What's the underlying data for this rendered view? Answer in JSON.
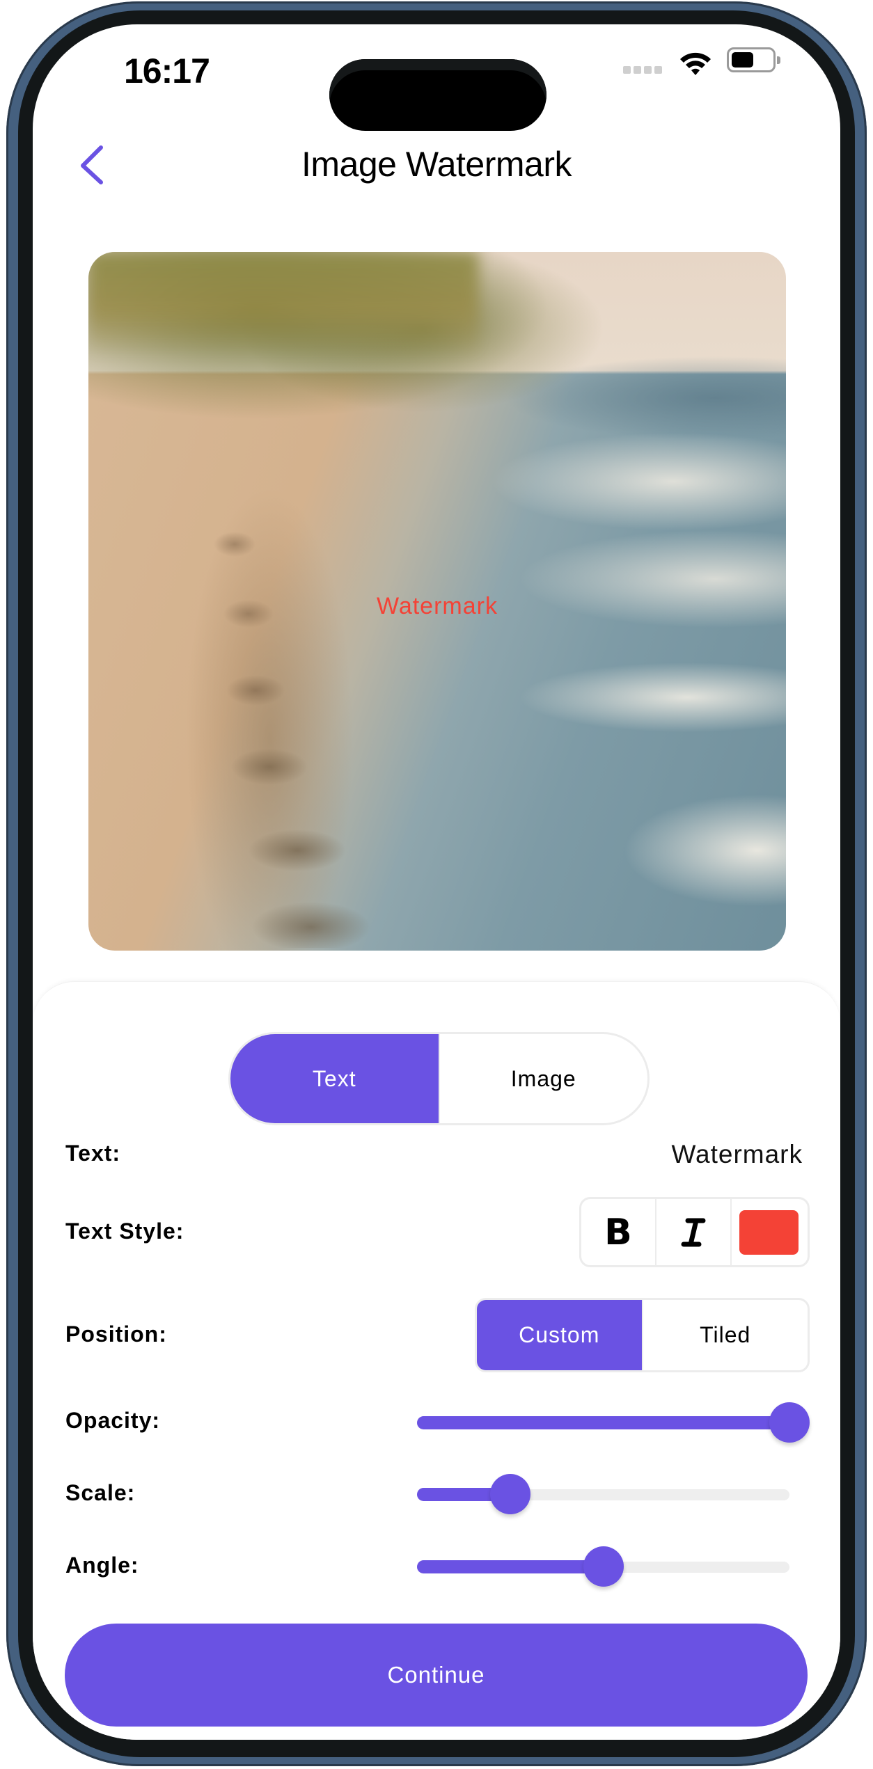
{
  "status_bar": {
    "time": "16:17",
    "icons": [
      "cellular-signal-icon",
      "wifi-icon",
      "battery-icon"
    ]
  },
  "header": {
    "back_icon": "chevron-left-icon",
    "title": "Image Watermark"
  },
  "preview": {
    "description": "beach photo with footprints in sand and waves",
    "watermark_text": "Watermark",
    "watermark_color": "#f44236"
  },
  "controls": {
    "type_toggle": {
      "options": [
        "Text",
        "Image"
      ],
      "selected": "Text"
    },
    "text_row": {
      "label": "Text:",
      "value": "Watermark"
    },
    "text_style_row": {
      "label": "Text Style:",
      "bold_label": "B",
      "italic_icon": "italic-icon",
      "color": "#f44236"
    },
    "position_row": {
      "label": "Position:",
      "options": [
        "Custom",
        "Tiled"
      ],
      "selected": "Custom"
    },
    "sliders": [
      {
        "label": "Opacity:",
        "value": 1.0
      },
      {
        "label": "Scale:",
        "value": 0.25
      },
      {
        "label": "Angle:",
        "value": 0.5
      }
    ]
  },
  "continue_label": "Continue",
  "colors": {
    "accent": "#6a52e3",
    "track": "#eeeeee",
    "frame": "#45607f",
    "bezel": "#131718"
  }
}
